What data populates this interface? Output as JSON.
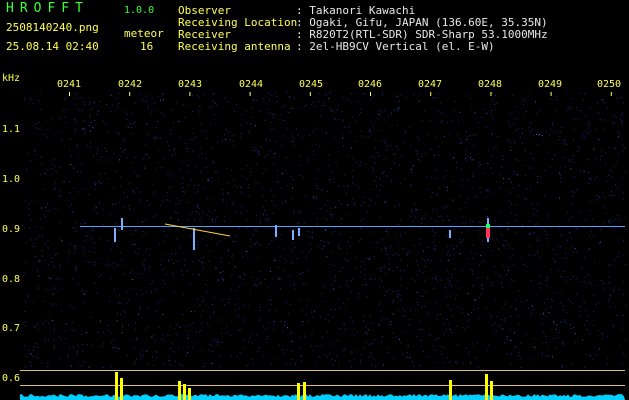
{
  "app": {
    "name": "HROFFT",
    "version": "1.0.0"
  },
  "file": {
    "name": "2508140240.png",
    "datetime": "25.08.14 02:40"
  },
  "meteor": {
    "label": "meteor",
    "count": "16"
  },
  "info": [
    {
      "key": "Observer",
      "value": ": Takanori Kawachi"
    },
    {
      "key": "Receiving Location",
      "value": ": Ogaki, Gifu, JAPAN (136.60E, 35.35N)"
    },
    {
      "key": "Receiver",
      "value": ": R820T2(RTL-SDR) SDR-Sharp 53.1000MHz"
    },
    {
      "key": "Receiving antenna",
      "value": ": 2el-HB9CV Vertical (el. E-W)"
    }
  ],
  "spectrogram": {
    "y_unit": "kHz",
    "y_ticks": [
      "1.1",
      "1.0",
      "0.9",
      "0.8",
      "0.7",
      "0.6"
    ],
    "time_ticks": [
      "0241",
      "0242",
      "0243",
      "0244",
      "0245",
      "0246",
      "0247",
      "0248",
      "0249",
      "0250"
    ],
    "colors": {
      "background": "#000000",
      "noise": "#1a2a8a",
      "carrier": "#4fa0ff",
      "level_baseline": "#00d0ff",
      "level_peak": "#ffff00",
      "tick": "#ffff55"
    }
  }
}
